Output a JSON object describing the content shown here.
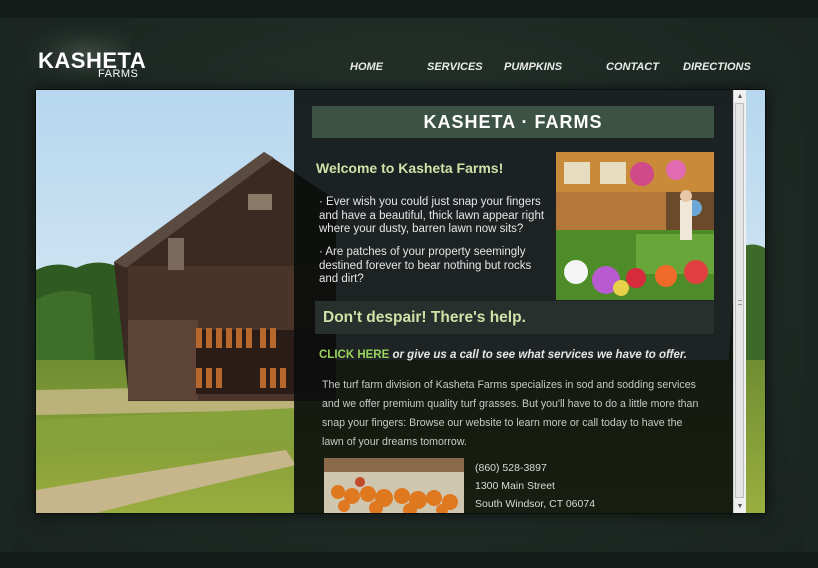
{
  "brand": {
    "name": "KASHETA",
    "sub": "FARMS"
  },
  "nav": [
    {
      "label": "HOME"
    },
    {
      "label": "SERVICES"
    },
    {
      "label": "PUMPKINS"
    },
    {
      "label": "CONTACT"
    },
    {
      "label": "DIRECTIONS"
    }
  ],
  "content": {
    "title": "KASHETA · FARMS",
    "welcome": "Welcome to Kasheta Farms!",
    "bullets": [
      "· Ever wish you could just snap your fingers and have a beautiful, thick lawn appear right where your dusty, barren lawn now sits?",
      "· Are patches of your property seemingly destined forever to bear nothing but rocks and dirt?"
    ],
    "despair": "Don't despair! There's help.",
    "cta_link": "CLICK HERE",
    "cta_rest": " or give us a call to see what services we have to offer.",
    "paragraph": "The turf farm division of Kasheta Farms specializes in sod and sodding services and we offer premium quality turf grasses. But you'll have to do a little more than snap your fingers: Browse our website to learn more or call today to have the lawn of your dreams tomorrow.",
    "contact": {
      "phone": "(860) 528-3897",
      "street": "1300 Main Street",
      "city": "South Windsor, CT 06074"
    }
  },
  "colors": {
    "accent_green": "#9ad35d",
    "heading_green": "#cfe2a8",
    "title_bar": "#3c5245",
    "background": "#1b2521"
  }
}
